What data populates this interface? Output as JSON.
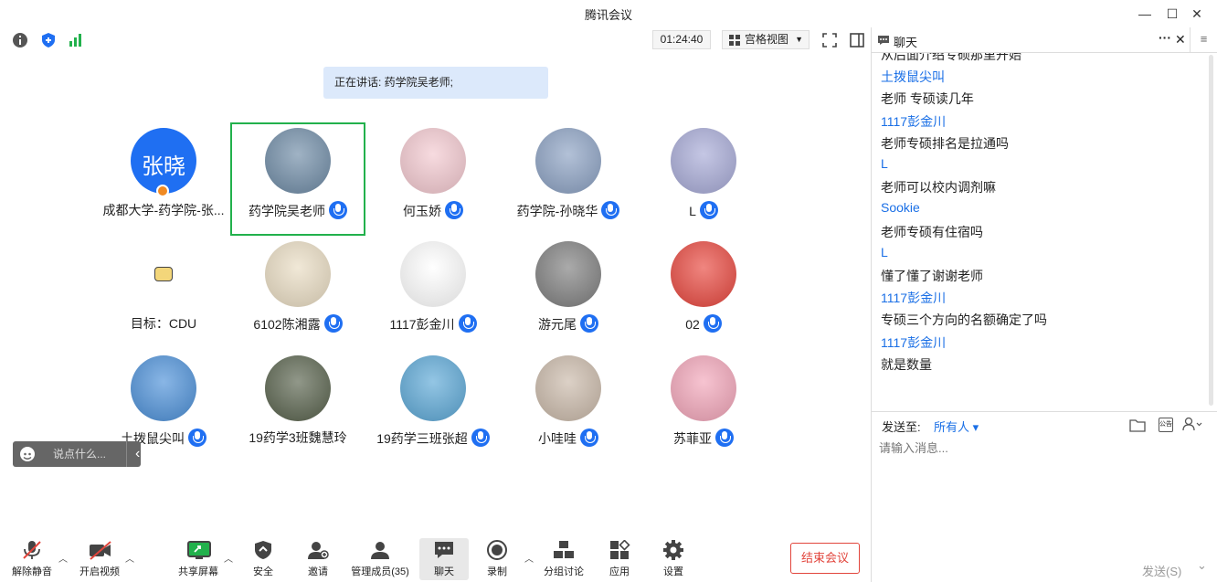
{
  "window": {
    "title": "腾讯会议",
    "minimize": "—",
    "maximize": "☐",
    "close": "✕"
  },
  "toolbar": {
    "timer": "01:24:40",
    "view_label": "宫格视图",
    "view_arrow": "▼"
  },
  "speaking": "正在讲话: 药学院吴老师;",
  "participants": [
    {
      "name": "成都大学-药学院-张...",
      "avatar_text": "张晓",
      "avatar_color": "#1f6ff2",
      "mic": false
    },
    {
      "name": "药学院吴老师",
      "avatar_text": "",
      "avatar_color": "#6d8aa5",
      "mic": true,
      "active": true
    },
    {
      "name": "何玉娇",
      "avatar_text": "",
      "avatar_color": "#f3c8cf",
      "mic": true
    },
    {
      "name": "药学院-孙晓华",
      "avatar_text": "",
      "avatar_color": "#8aa0c2",
      "mic": true
    },
    {
      "name": "L",
      "avatar_text": "",
      "avatar_color": "#a6a9d6",
      "mic": true
    },
    {
      "name": "目标：CDU",
      "avatar_text": "",
      "avatar_color": "#ffffff",
      "mic": false
    },
    {
      "name": "6102陈湘露",
      "avatar_text": "",
      "avatar_color": "#e9dcc2",
      "mic": true
    },
    {
      "name": "1117彭金川",
      "avatar_text": "",
      "avatar_color": "#ffffff",
      "mic": true
    },
    {
      "name": "游元尾",
      "avatar_text": "",
      "avatar_color": "#7d7d7d",
      "mic": true
    },
    {
      "name": "02",
      "avatar_text": "",
      "avatar_color": "#e8453c",
      "mic": true
    },
    {
      "name": "土拨鼠尖叫",
      "avatar_text": "",
      "avatar_color": "#4a8fd8",
      "mic": true
    },
    {
      "name": "19药学3班魏慧玲",
      "avatar_text": "",
      "avatar_color": "#56604a",
      "mic": false
    },
    {
      "name": "19药学三班张超",
      "avatar_text": "",
      "avatar_color": "#5aa7d6",
      "mic": true
    },
    {
      "name": "小哇哇",
      "avatar_text": "",
      "avatar_color": "#c9b8a8",
      "mic": true
    },
    {
      "name": "苏菲亚",
      "avatar_text": "",
      "avatar_color": "#f2a4b8",
      "mic": true
    }
  ],
  "float_input": {
    "placeholder": "说点什么...",
    "arrow": "‹"
  },
  "bottom": {
    "unmute": "解除静音",
    "video": "开启视频",
    "share": "共享屏幕",
    "security": "安全",
    "invite": "邀请",
    "members": "管理成员(35)",
    "chat": "聊天",
    "record": "录制",
    "breakout": "分组讨论",
    "apps": "应用",
    "settings": "设置",
    "end": "结束会议"
  },
  "chat": {
    "title": "聊天",
    "more": "···",
    "close": "✕",
    "messages": [
      {
        "kind": "t",
        "text": "从后面介绍专硕那里开始"
      },
      {
        "kind": "s",
        "text": "土拨鼠尖叫"
      },
      {
        "kind": "t",
        "text": "老师 专硕读几年"
      },
      {
        "kind": "s",
        "text": "1117彭金川"
      },
      {
        "kind": "t",
        "text": "老师专硕排名是拉通吗"
      },
      {
        "kind": "s",
        "text": "L"
      },
      {
        "kind": "t",
        "text": "老师可以校内调剂嘛"
      },
      {
        "kind": "s",
        "text": "Sookie"
      },
      {
        "kind": "t",
        "text": "老师专硕有住宿吗"
      },
      {
        "kind": "s",
        "text": "L"
      },
      {
        "kind": "t",
        "text": "懂了懂了谢谢老师"
      },
      {
        "kind": "s",
        "text": "1117彭金川"
      },
      {
        "kind": "t",
        "text": "专硕三个方向的名额确定了吗"
      },
      {
        "kind": "s",
        "text": "1117彭金川"
      },
      {
        "kind": "t",
        "text": "就是数量"
      }
    ],
    "send_to_label": "发送至:",
    "send_to_value": "所有人",
    "send_to_arrow": "▾",
    "placeholder": "请输入消息...",
    "send_button": "发送(S)",
    "send_arrow": "⌄",
    "public_icon_text": "公告"
  }
}
